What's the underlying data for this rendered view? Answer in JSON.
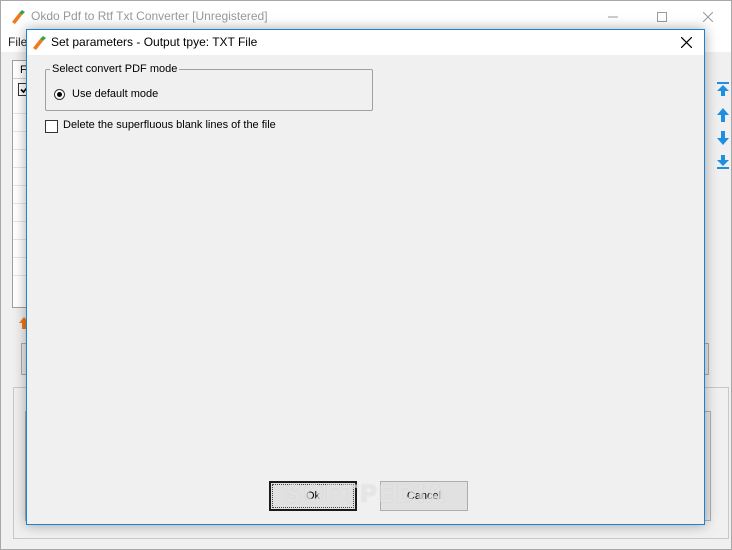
{
  "main_window": {
    "title": "Okdo Pdf to Rtf Txt Converter [Unregistered]",
    "menu": {
      "file_label": "File"
    },
    "file_list": {
      "column_header": "F"
    }
  },
  "dialog": {
    "title": "Set parameters - Output tpye: TXT File",
    "group": {
      "legend": "Select convert PDF mode",
      "radio_label": "Use default mode"
    },
    "checkbox_label": "Delete the superfluous blank lines of the file",
    "ok_label": "Ok",
    "cancel_label": "Cancel"
  },
  "watermark": "SOFTPEDIA",
  "colors": {
    "accent": "#1883d7",
    "arrow_blue": "#1e8fe1",
    "icon_orange": "#f07a1a",
    "icon_green": "#3aa34a"
  },
  "icons": {
    "app": "okdo-app-icon",
    "side_arrows": [
      "move-top-icon",
      "move-up-icon",
      "move-down-icon",
      "move-bottom-icon"
    ]
  }
}
